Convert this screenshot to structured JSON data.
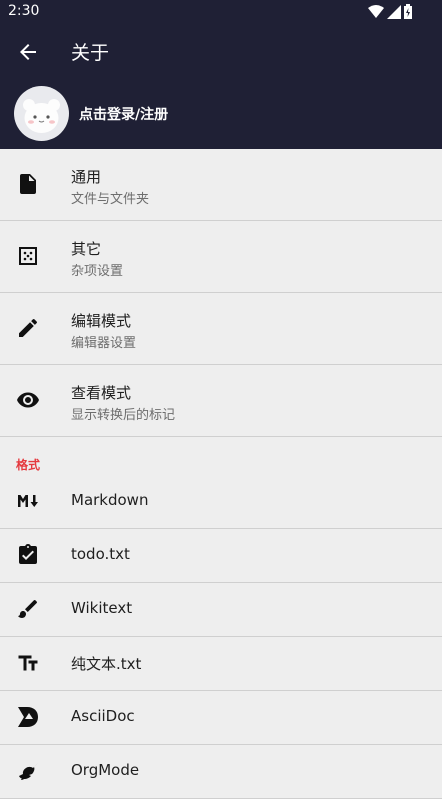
{
  "status_bar": {
    "time": "2:30"
  },
  "app_bar": {
    "title": "关于"
  },
  "account": {
    "login_label": "点击登录/注册"
  },
  "settings": [
    {
      "title": "通用",
      "subtitle": "文件与文件夹"
    },
    {
      "title": "其它",
      "subtitle": "杂项设置"
    },
    {
      "title": "编辑模式",
      "subtitle": "编辑器设置"
    },
    {
      "title": "查看模式",
      "subtitle": "显示转换后的标记"
    }
  ],
  "formats_section": {
    "header": "格式",
    "items": [
      "Markdown",
      "todo.txt",
      "Wikitext",
      "纯文本.txt",
      "AsciiDoc",
      "OrgMode"
    ]
  },
  "colors": {
    "header_bg": "#1f2035",
    "accent": "#e5393e",
    "background": "#eeeeee"
  }
}
